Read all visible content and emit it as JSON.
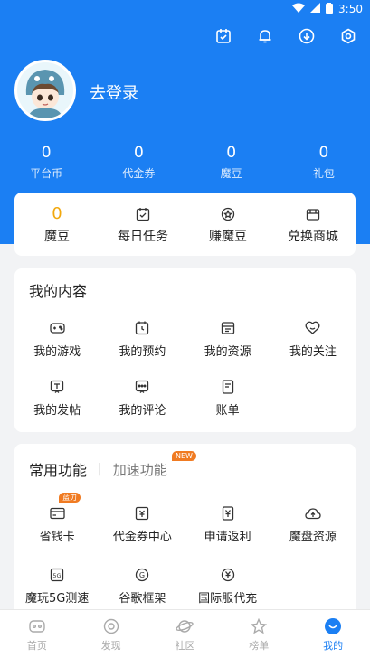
{
  "status_bar": {
    "time": "3:50"
  },
  "profile": {
    "login_text": "去登录"
  },
  "stats": [
    {
      "value": "0",
      "label": "平台币"
    },
    {
      "value": "0",
      "label": "代金券"
    },
    {
      "value": "0",
      "label": "魔豆"
    },
    {
      "value": "0",
      "label": "礼包"
    }
  ],
  "modou_card": {
    "balance": "0",
    "balance_label": "魔豆",
    "items": [
      {
        "label": "每日任务",
        "icon": "calendar-check-icon"
      },
      {
        "label": "赚魔豆",
        "icon": "coin-icon"
      },
      {
        "label": "兑换商城",
        "icon": "gift-box-icon"
      }
    ]
  },
  "my_content": {
    "title": "我的内容",
    "items": [
      {
        "label": "我的游戏",
        "icon": "gamepad-icon"
      },
      {
        "label": "我的预约",
        "icon": "clock-icon"
      },
      {
        "label": "我的资源",
        "icon": "folder-icon"
      },
      {
        "label": "我的关注",
        "icon": "heart-icon"
      },
      {
        "label": "我的发帖",
        "icon": "post-icon"
      },
      {
        "label": "我的评论",
        "icon": "comment-icon"
      },
      {
        "label": "账单",
        "icon": "bill-icon"
      }
    ]
  },
  "functions": {
    "tab_active": "常用功能",
    "tab_separator": "|",
    "tab_inactive": "加速功能",
    "new_badge": "NEW",
    "items": [
      {
        "label": "省钱卡",
        "icon": "card-icon",
        "badge": "蓝刃"
      },
      {
        "label": "代金券中心",
        "icon": "ticket-icon"
      },
      {
        "label": "申请返利",
        "icon": "yen-receipt-icon"
      },
      {
        "label": "魔盘资源",
        "icon": "cloud-upload-icon"
      },
      {
        "label": "魔玩5G测速",
        "icon": "5g-icon"
      },
      {
        "label": "谷歌框架",
        "icon": "google-icon"
      },
      {
        "label": "国际服代充",
        "icon": "yen-circle-icon"
      }
    ]
  },
  "tabbar": [
    {
      "label": "首页",
      "icon": "home-gamepad-icon",
      "active": false
    },
    {
      "label": "发现",
      "icon": "discover-icon",
      "active": false
    },
    {
      "label": "社区",
      "icon": "planet-icon",
      "active": false
    },
    {
      "label": "榜单",
      "icon": "star-icon",
      "active": false
    },
    {
      "label": "我的",
      "icon": "profile-icon",
      "active": true
    }
  ],
  "colors": {
    "brand": "#1b7ff3",
    "accent_orange": "#f07b22",
    "gold": "#f2a80d"
  }
}
